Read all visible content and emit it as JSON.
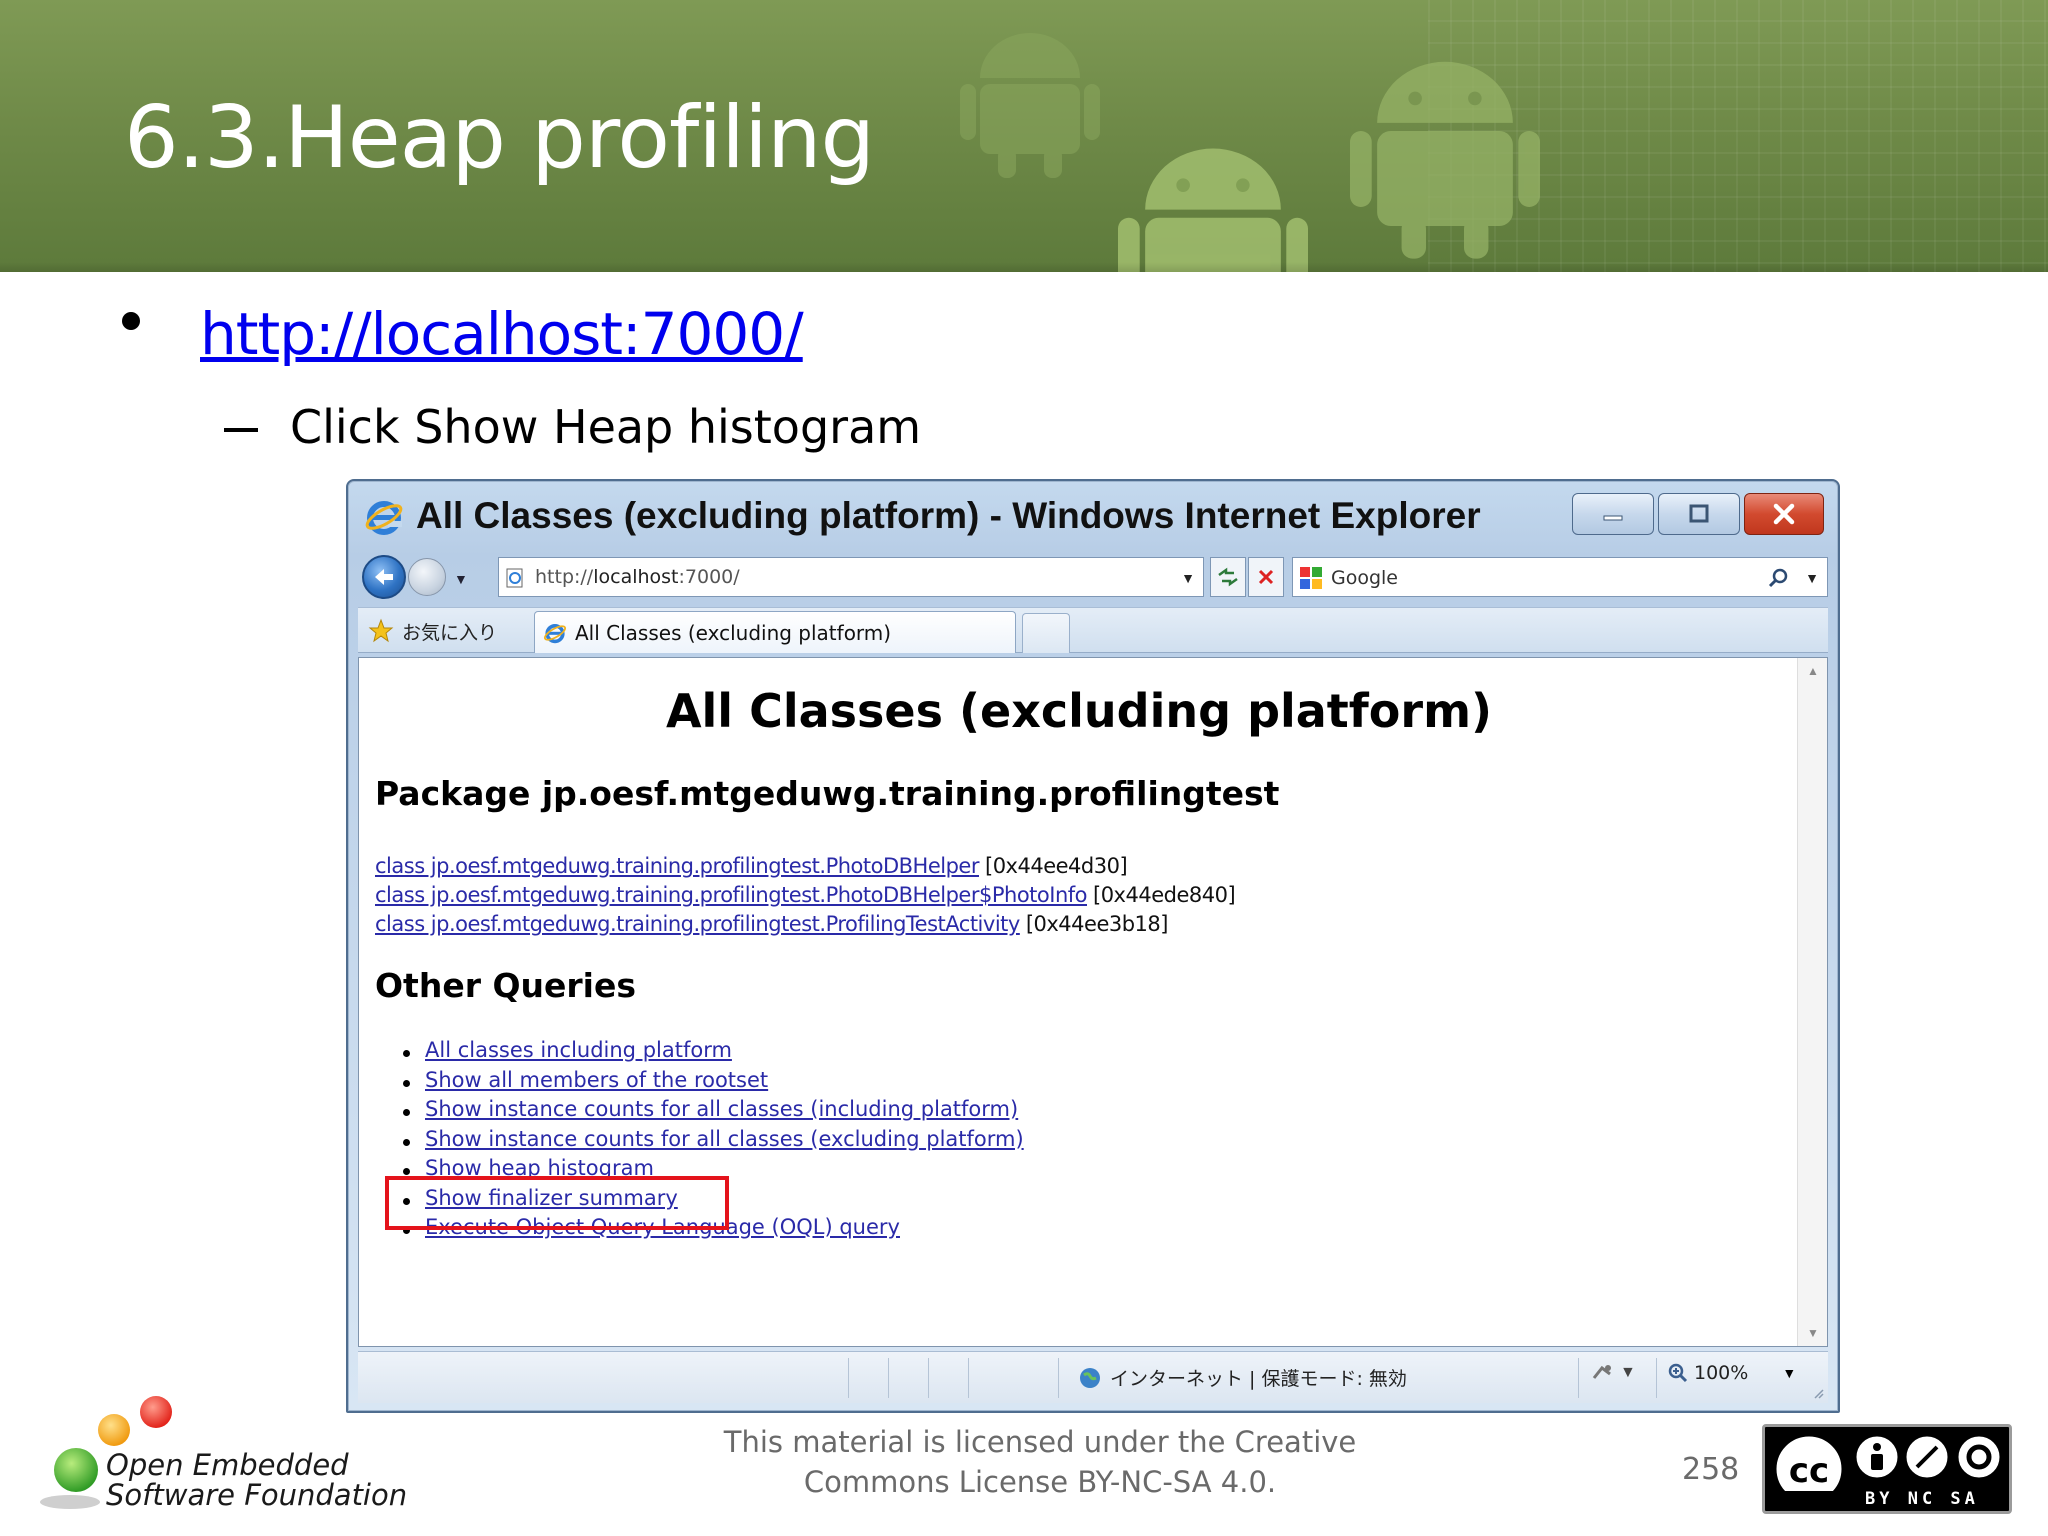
{
  "slide": {
    "title": "6.3.Heap profiling",
    "bullet_link": "http://localhost:7000/",
    "sub_bullet": "Click Show Heap histogram",
    "page_number": "258",
    "license_line1": "This material is licensed under the Creative",
    "license_line2": "Commons License BY-NC-SA 4.0.",
    "org_line1": "Open Embedded",
    "org_line2": "Software Foundation",
    "cc_badge_terms": "BY NC SA",
    "cc_badge_cc": "cc"
  },
  "browser": {
    "window_title": "All Classes (excluding platform) - Windows Internet Explorer",
    "address_prefix": "http://",
    "address_host": "localhost",
    "address_suffix": ":7000/",
    "search_placeholder": "Google",
    "favorites_label": "お気に入り",
    "tab_label": "All Classes (excluding platform)",
    "status_zone": "インターネット | 保護モード: 無効",
    "zoom_level": "100%"
  },
  "page": {
    "heading": "All Classes (excluding platform)",
    "package_heading": "Package jp.oesf.mtgeduwg.training.profilingtest",
    "classes": [
      {
        "name": "class jp.oesf.mtgeduwg.training.profilingtest.PhotoDBHelper",
        "address": "[0x44ee4d30]"
      },
      {
        "name": "class jp.oesf.mtgeduwg.training.profilingtest.PhotoDBHelper$PhotoInfo",
        "address": "[0x44ede840]"
      },
      {
        "name": "class jp.oesf.mtgeduwg.training.profilingtest.ProfilingTestActivity",
        "address": "[0x44ee3b18]"
      }
    ],
    "other_heading": "Other Queries",
    "queries": [
      "All classes including platform",
      "Show all members of the rootset",
      "Show instance counts for all classes (including platform)",
      "Show instance counts for all classes (excluding platform)",
      "Show heap histogram",
      "Show finalizer summary",
      "Execute Object Query Language (OQL) query"
    ]
  },
  "colors": {
    "banner": "#6f8a48",
    "link": "#2a2aa8",
    "highlight": "#e4131b"
  }
}
